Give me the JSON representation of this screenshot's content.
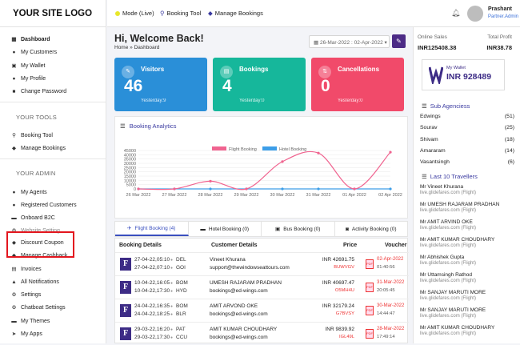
{
  "logo": "YOUR SITE LOGO",
  "sidebar": {
    "main_items": [
      {
        "label": "Dashboard",
        "icon": "dashboard-icon"
      },
      {
        "label": "My Customers",
        "icon": "user-icon"
      },
      {
        "label": "My Wallet",
        "icon": "wallet-icon"
      },
      {
        "label": "My Profile",
        "icon": "profile-icon"
      },
      {
        "label": "Change Password",
        "icon": "lock-icon"
      }
    ],
    "tools_heading": "YOUR TOOLS",
    "tools_items": [
      {
        "label": "Booking Tool",
        "icon": "search-icon"
      },
      {
        "label": "Manage Bookings",
        "icon": "tag-icon"
      }
    ],
    "admin_heading": "YOUR ADMIN",
    "admin_items": [
      {
        "label": "My Agents",
        "icon": "users-icon"
      },
      {
        "label": "Registered Customers",
        "icon": "users-icon"
      },
      {
        "label": "Onboard B2C",
        "icon": "briefcase-icon"
      },
      {
        "label": "Website Setting",
        "icon": "settings-icon"
      },
      {
        "label": "Discount Coupon",
        "icon": "coupon-icon"
      },
      {
        "label": "Manage Cashback",
        "icon": "cashback-icon"
      },
      {
        "label": "Invoices",
        "icon": "invoice-icon"
      },
      {
        "label": "All Notifications",
        "icon": "bell-icon"
      },
      {
        "label": "Settings",
        "icon": "gear-icon"
      },
      {
        "label": "Chatboat Settings",
        "icon": "chat-icon"
      },
      {
        "label": "My Themes",
        "icon": "theme-icon"
      },
      {
        "label": "My Apps",
        "icon": "app-icon"
      }
    ]
  },
  "topbar": {
    "mode": "Mode (Live)",
    "booking_tool": "Booking Tool",
    "manage_bookings": "Manage Bookings",
    "user_name": "Prashant",
    "user_role": "Partner.Admin"
  },
  "header": {
    "welcome": "Hi, Welcome Back!",
    "breadcrumb": "Home » Dashboard",
    "date_range": "26-Mar-2022 : 02-Apr-2022"
  },
  "cards": [
    {
      "title": "Visitors",
      "value": "46",
      "yesterday": "Yesterday:9",
      "color": "#2a8fd8"
    },
    {
      "title": "Bookings",
      "value": "4",
      "yesterday": "Yesterday:0",
      "color": "#16b79b"
    },
    {
      "title": "Cancellations",
      "value": "0",
      "yesterday": "Yesterday:0",
      "color": "#f14a6a"
    }
  ],
  "chart_data": {
    "type": "line",
    "title": "Booking Analytics",
    "categories": [
      "26 Mar 2022",
      "27 Mar 2022",
      "28 Mar 2022",
      "29 Mar 2022",
      "30 Mar 2022",
      "31 Mar 2022",
      "01 Apr 2022",
      "02 Apr 2022"
    ],
    "series": [
      {
        "name": "Flight Booking",
        "color": "#f06490",
        "values": [
          0,
          0,
          9000,
          0,
          32000,
          42000,
          0,
          43000
        ]
      },
      {
        "name": "Hotel Booking",
        "color": "#3d9ee8",
        "values": [
          0,
          0,
          0,
          0,
          0,
          0,
          0,
          0
        ]
      }
    ],
    "y_ticks": [
      "0",
      "5000",
      "10000",
      "15000",
      "20000",
      "25000",
      "30000",
      "35000",
      "40000",
      "45000"
    ],
    "ylim": [
      0,
      45000
    ],
    "legend": "top-center"
  },
  "tabs": [
    {
      "label": "Flight Booking (4)",
      "icon": "plane-icon"
    },
    {
      "label": "Hotel Booking (0)",
      "icon": "bed-icon"
    },
    {
      "label": "Bus Booking (0)",
      "icon": "bus-icon"
    },
    {
      "label": "Activity Booking (0)",
      "icon": "camera-icon"
    }
  ],
  "table": {
    "headers": [
      "Booking Details",
      "Customer Details",
      "Price",
      "Voucher"
    ],
    "rows": [
      {
        "dep": "27-04-22,05:10",
        "dep_code": "DEL",
        "arr": "27-04-22,07:10",
        "arr_code": "GOI",
        "name": "Vineet Khurana",
        "email": "support@thewindowseattours.com",
        "price": "INR 42691.75",
        "pnr": "BUWVGV",
        "date": "02-Apr-2022",
        "time": "01:40:56"
      },
      {
        "dep": "10-04-22,16:05",
        "dep_code": "BOM",
        "arr": "10-04-22,17:30",
        "arr_code": "HYD",
        "name": "UMESH RAJARAM PRADHAN",
        "email": "bookings@ed-wings.com",
        "price": "INR 40697.47",
        "pnr": "O5MH4U",
        "date": "31-Mar-2022",
        "time": "20:05:45"
      },
      {
        "dep": "24-04-22,16:35",
        "dep_code": "BOM",
        "arr": "24-04-22,18:25",
        "arr_code": "BLR",
        "name": "AMIT ARVOND OKE",
        "email": "bookings@ed-wings.com",
        "price": "INR 32179.24",
        "pnr": "G7BVSY",
        "date": "30-Mar-2022",
        "time": "14:44:47"
      },
      {
        "dep": "29-03-22,16:20",
        "dep_code": "PAT",
        "arr": "29-03-22,17:30",
        "arr_code": "CCU",
        "name": "AMIT KUMAR CHOUDHARY",
        "email": "bookings@ed-wings.com",
        "price": "INR 9839.92",
        "pnr": "IGL49L",
        "date": "28-Mar-2022",
        "time": "17:49:14"
      }
    ]
  },
  "right": {
    "online_sales_label": "Online Sales",
    "online_sales": "INR125408.38",
    "total_profit_label": "Total Profit",
    "total_profit": "INR38.78",
    "wallet_title": "My Wallet",
    "wallet_amount": "INR 928489",
    "agencies_title": "Sub Agenciess",
    "agencies": [
      {
        "name": "Edwings",
        "count": "(51)"
      },
      {
        "name": "Sourav",
        "count": "(25)"
      },
      {
        "name": "Shivam",
        "count": "(18)"
      },
      {
        "name": "Amararam",
        "count": "(14)"
      },
      {
        "name": "Vasantsingh",
        "count": "(6)"
      }
    ],
    "travellers_title": "Last 10 Travellers",
    "travellers": [
      {
        "name": "Mr Vineet Khurana",
        "site": "live.glidefares.com (Flight)"
      },
      {
        "name": "Mr UMESH RAJARAM PRADHAN",
        "site": "live.glidefares.com (Flight)"
      },
      {
        "name": "Mr AMIT ARVIND OKE",
        "site": "live.glidefares.com (Flight)"
      },
      {
        "name": "Mr AMIT KUMAR CHOUDHARY",
        "site": "live.glidefares.com (Flight)"
      },
      {
        "name": "Mr Abhishek Gupta",
        "site": "live.glidefares.com (Flight)"
      },
      {
        "name": "Mr Uttamsingh Rathod",
        "site": "live.glidefares.com (Flight)"
      },
      {
        "name": "Mr SANJAY MARUTI MORE",
        "site": "live.glidefares.com (Flight)"
      },
      {
        "name": "Mr SANJAY MARUTI MORE",
        "site": "live.glidefares.com (Flight)"
      },
      {
        "name": "Mr AMIT KUMAR CHOUDHARY",
        "site": "live.glidefares.com (Flight)"
      }
    ]
  }
}
